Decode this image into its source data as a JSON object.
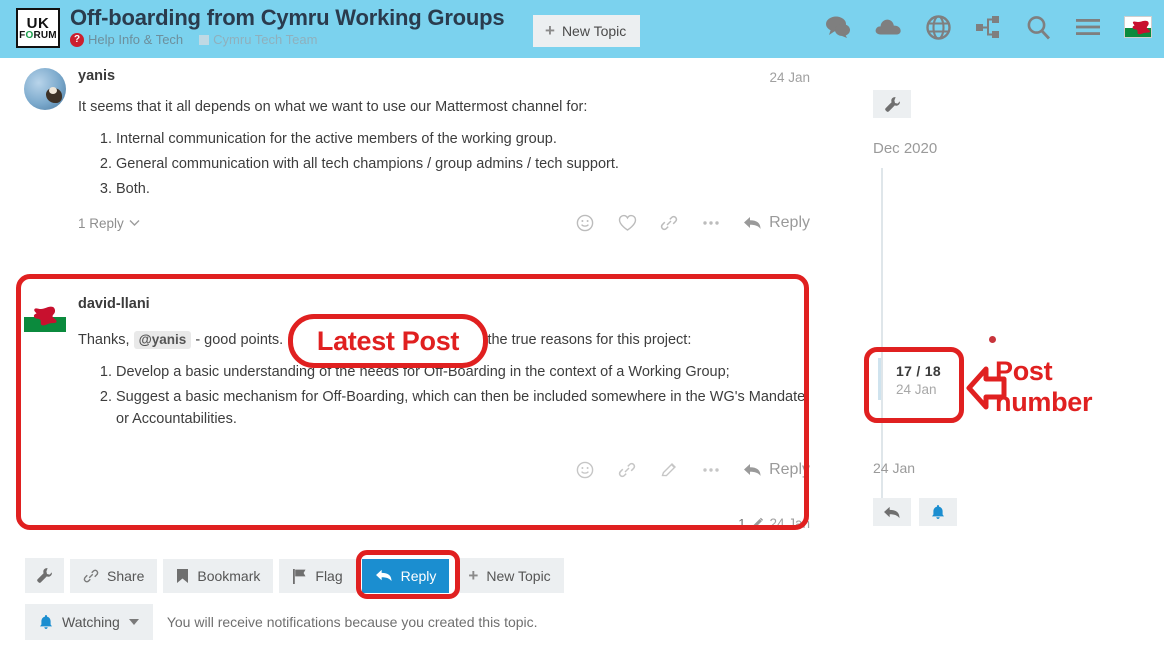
{
  "header": {
    "logo": {
      "line1": "UK",
      "line2_pre": "F",
      "line2_o": "O",
      "line2_post": "RUM"
    },
    "topic_title": "Off-boarding from Cymru Working Groups",
    "breadcrumb": {
      "category": "Help Info & Tech",
      "category_icon": "question-mark-badge-icon",
      "subcategory": "Cymru Tech Team"
    },
    "new_topic_label": "New Topic",
    "icons": [
      "chat-bubbles-icon",
      "cloud-icon",
      "globe-icon",
      "sitemap-icon",
      "search-icon",
      "hamburger-menu-icon"
    ],
    "avatar_alt": "welsh-flag-avatar",
    "bg_color": "#7bd2ee"
  },
  "posts": [
    {
      "author": "yanis",
      "date": "24 Jan",
      "avatar": "photo-avatar",
      "body_intro": "It seems that it all depends on what we want to use our Mattermost channel for:",
      "list": [
        "Internal communication for the active members of the working group.",
        "General communication with all tech champions / group admins / tech support.",
        "Both."
      ],
      "replies_label": "1 Reply",
      "reply_label": "Reply",
      "action_icons": [
        "emoji-icon",
        "heart-icon",
        "link-icon",
        "ellipsis-icon"
      ]
    },
    {
      "author": "david-llani",
      "date": "24 Jan",
      "avatar": "welsh-flag-avatar",
      "edit_count": "1",
      "body_intro_a": "Thanks, ",
      "mention": "@yanis",
      "body_intro_b": " - good points. I think we're starting to get into the true reasons for this project:",
      "list": [
        "Develop a basic understanding of the needs for Off-Boarding in the context of a Working Group;",
        "Suggest a basic mechanism for Off-Boarding, which can then be included somewhere in the WG's Mandate or Accountabilities."
      ],
      "reply_label": "Reply",
      "action_icons": [
        "emoji-icon",
        "link-icon",
        "pencil-edit-icon",
        "ellipsis-icon"
      ]
    }
  ],
  "annotations": {
    "latest_post": "Latest Post",
    "post_number_line1": "Post",
    "post_number_line2": "number",
    "color": "#e02020"
  },
  "toolbar": {
    "wrench_icon": "wrench-icon",
    "share_label": "Share",
    "bookmark_label": "Bookmark",
    "flag_label": "Flag",
    "reply_label": "Reply",
    "new_topic_label": "New Topic",
    "primary_color": "#1b8ed0"
  },
  "watching": {
    "label": "Watching",
    "note": "You will receive notifications because you created this topic."
  },
  "timeline": {
    "wrench_icon": "wrench-icon",
    "month": "Dec 2020",
    "current_post": "17 / 18",
    "current_date": "24 Jan",
    "last_date": "24 Jan",
    "buttons": [
      "reply-arrow-icon",
      "notification-bell-icon"
    ]
  }
}
